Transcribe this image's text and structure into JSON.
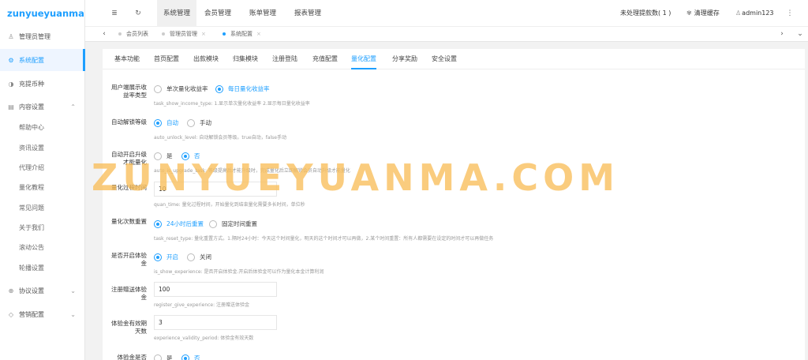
{
  "brand": {
    "logo_text": "zunyueyuanma.com"
  },
  "sidebar": {
    "items": [
      {
        "label": "管理员管理",
        "icon": "user-icon"
      },
      {
        "label": "系统配置",
        "icon": "gear-icon",
        "active": true
      },
      {
        "label": "充提币种",
        "icon": "coin-icon"
      },
      {
        "label": "内容设置",
        "icon": "document-icon",
        "expanded": true
      }
    ],
    "submenu": [
      "帮助中心",
      "资讯设置",
      "代理介绍",
      "量化教程",
      "常见问题",
      "关于我们",
      "滚动公告",
      "轮播设置"
    ],
    "bottom_items": [
      {
        "label": "协议设置",
        "icon": "globe-icon"
      },
      {
        "label": "营销配置",
        "icon": "diamond-icon"
      }
    ]
  },
  "header": {
    "icons": {
      "menu": "≣",
      "refresh": "↻",
      "more": "⋮"
    },
    "nav": [
      "系统管理",
      "会员管理",
      "账单管理",
      "报表管理"
    ],
    "pending_withdraw": "未处理提款数( 1 )",
    "clear_cache": "清理缓存",
    "clear_cache_icon": "✾",
    "user": "admin123",
    "user_icon": "♙"
  },
  "tabbar": {
    "prev": "‹",
    "next": "›",
    "down": "⌄",
    "close_symbol": "×",
    "tabs": [
      {
        "label": "会员列表",
        "active": false,
        "closable": false
      },
      {
        "label": "管理员管理",
        "active": false,
        "closable": true
      },
      {
        "label": "系统配置",
        "active": true,
        "closable": true
      }
    ]
  },
  "config": {
    "tabs": [
      "基本功能",
      "首页配置",
      "出款模块",
      "归集模块",
      "注册登陆",
      "充值配置",
      "量化配置",
      "分享奖励",
      "安全设置"
    ],
    "active_tab": "量化配置",
    "fields": {
      "show_income": {
        "label": "用户端展示收益率类型",
        "options": [
          "单次量化收益率",
          "每日量化收益率"
        ],
        "hint": "task_show_income_type: 1.显示单次量化收益率 2.显示每日量化收益率"
      },
      "auto_unlock": {
        "label": "自动解锁等级",
        "options": [
          "自动",
          "手动"
        ],
        "hint": "auto_unlock_level: 自动解锁会员等级。true自动，false手动"
      },
      "upgrade_task": {
        "label": "自动开启升级才能量化",
        "options": [
          "是",
          "否"
        ],
        "hint": "auto_is_upgrade_task: 等级提高后才能升级时，完成量化后立即解锁会员自动升级才能量化"
      },
      "quan_time": {
        "label": "量化过程时间",
        "value": "10",
        "hint": "quan_time: 量化过程时间，开始量化到结束量化需要多长时间，单位秒"
      },
      "reset_type": {
        "label": "量化次数重置",
        "options": [
          "24小时后重置",
          "固定时间重置"
        ],
        "hint": "task_reset_type: 量化重置方式。1.隔时24小时：今天这个时间量化，明天的这个时间才可以再做，2.某个时间重置：所有人都需要在设定的时间才可以再做任务"
      },
      "experience": {
        "label": "是否开启体验金",
        "options": [
          "开启",
          "关闭"
        ],
        "hint": "is_show_experience: 是否开启体验金.开启后体验金可以作为量化本金计算利润"
      },
      "register_give": {
        "label": "注册赠送体验金",
        "value": "100",
        "hint": "register_give_experience: 注册赠送体验金"
      },
      "validity": {
        "label": "体验金有效期天数",
        "value": "3",
        "hint": "experience_validity_period: 体验金有效天数"
      },
      "last": {
        "label": "体验金是否",
        "options": [
          "是",
          "否"
        ]
      }
    }
  },
  "watermark": "ZUNYUEYUANMA.COM",
  "colors": {
    "accent": "#1e9fff",
    "watermark": "#f8be5a"
  }
}
